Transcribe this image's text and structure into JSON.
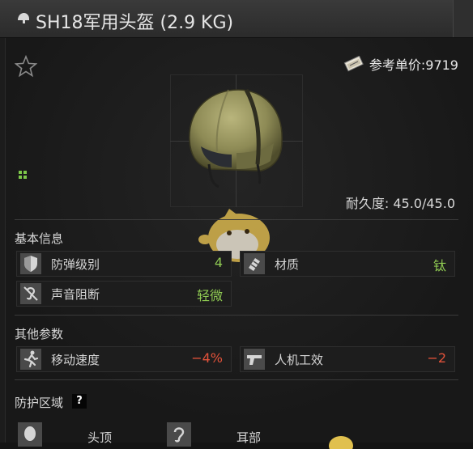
{
  "window": {
    "title": "SH18军用头盔 (2.9 KG)",
    "icon": "helmet-icon"
  },
  "item": {
    "price_label": "参考单价:9719",
    "price_icon": "money-icon",
    "durability_label": "耐久度: 45.0/45.0",
    "favorite_icon": "star-outline-icon",
    "size_icon": "grid-size-icon",
    "image": "sh18-helmet"
  },
  "sections": {
    "basic": {
      "title": "基本信息",
      "stats": [
        {
          "label": "防弹级别",
          "value": "4",
          "icon": "armor-shield-icon",
          "color": "#8fca52"
        },
        {
          "label": "材质",
          "value": "钛",
          "icon": "material-icon",
          "color": "#8fca52"
        },
        {
          "label": "声音阻断",
          "value": "轻微",
          "icon": "hearing-blocked-icon",
          "color": "#8fca52"
        }
      ]
    },
    "other": {
      "title": "其他参数",
      "stats": [
        {
          "label": "移动速度",
          "value": "−4%",
          "icon": "running-icon",
          "color": "#e2523a"
        },
        {
          "label": "人机工效",
          "value": "−2",
          "icon": "pistol-icon",
          "color": "#e2523a"
        }
      ]
    },
    "protection": {
      "title": "防护区域",
      "help": "?",
      "zones": [
        {
          "label": "头顶",
          "icon": "head-icon"
        },
        {
          "label": "耳部",
          "icon": "ear-icon"
        }
      ]
    }
  }
}
